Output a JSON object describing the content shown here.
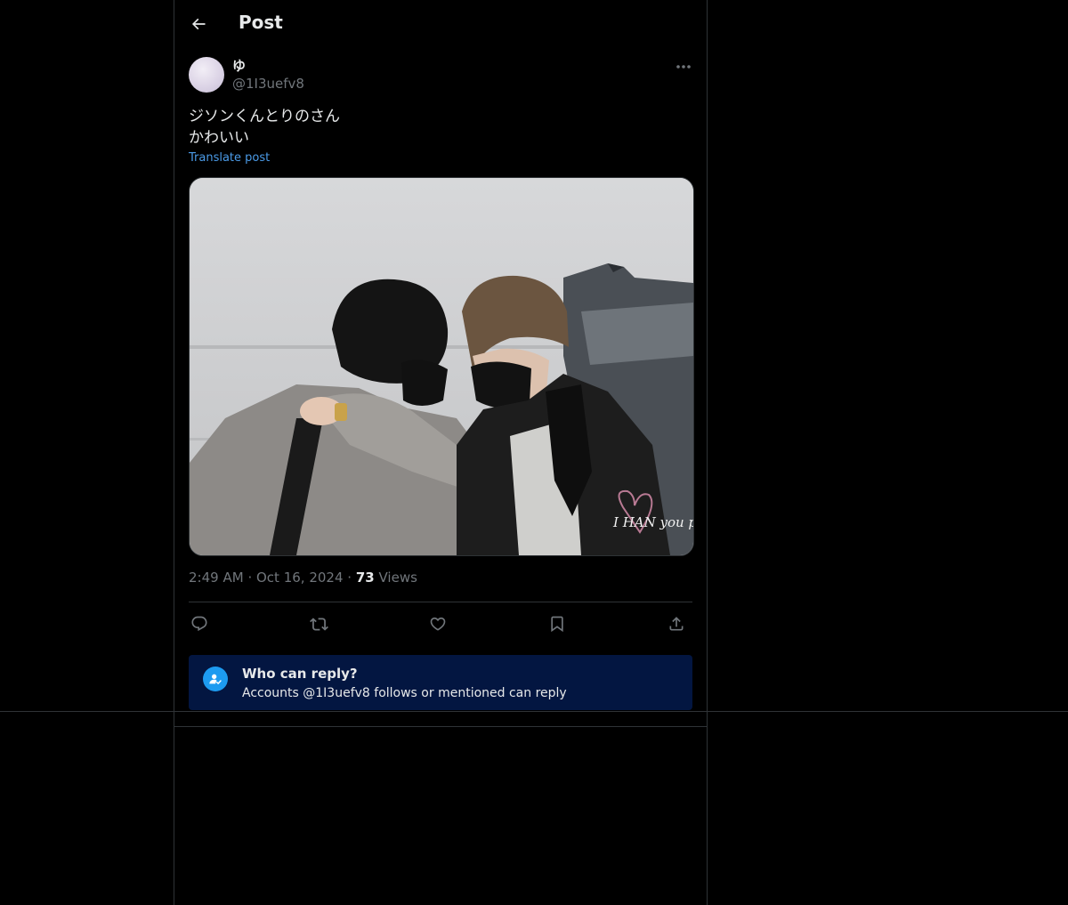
{
  "header": {
    "title": "Post"
  },
  "author": {
    "display_name": "ゆ",
    "handle": "@1I3uefv8"
  },
  "post": {
    "text_lines": [
      "ジソンくんとりのさん",
      "かわいい"
    ],
    "translate_label": "Translate post",
    "image_watermark": "I HAN you pre"
  },
  "meta": {
    "time": "2:49 AM",
    "separator": "·",
    "date": "Oct 16, 2024",
    "views_count": "73",
    "views_label": "Views"
  },
  "actions": [
    {
      "name": "reply",
      "icon": "reply-icon"
    },
    {
      "name": "repost",
      "icon": "repost-icon"
    },
    {
      "name": "like",
      "icon": "heart-icon"
    },
    {
      "name": "bookmark",
      "icon": "bookmark-icon"
    },
    {
      "name": "share",
      "icon": "share-icon"
    }
  ],
  "reply_restriction": {
    "title": "Who can reply?",
    "description": "Accounts @1I3uefv8 follows or mentioned can reply"
  },
  "colors": {
    "background": "#000000",
    "text": "#e7e9ea",
    "secondary_text": "#71767b",
    "link": "#4b9be8",
    "accent": "#1d9bf0",
    "reply_box": "#031641",
    "border": "#2f3336"
  }
}
